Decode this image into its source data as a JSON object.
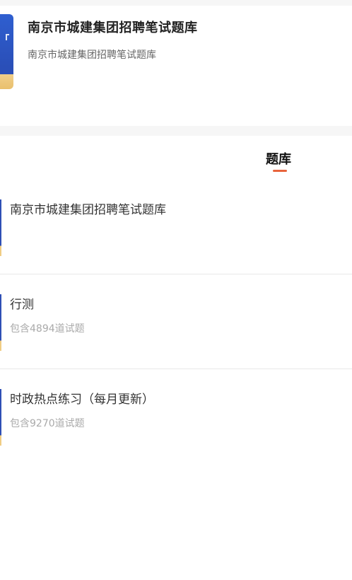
{
  "header": {
    "title": "南京市城建集团招聘笔试题库",
    "subtitle": "南京市城建集团招聘笔试题库"
  },
  "tabs": {
    "active_label": "题库"
  },
  "items": [
    {
      "title": "南京市城建集团招聘笔试题库",
      "meta": ""
    },
    {
      "title": "行测",
      "meta": "包含4894道试题"
    },
    {
      "title": "时政热点练习（每月更新）",
      "meta": "包含9270道试题"
    }
  ],
  "colors": {
    "accent": "#e8643c",
    "cover_blue": "#2f5fd0",
    "cover_gold": "#f0cd84"
  }
}
